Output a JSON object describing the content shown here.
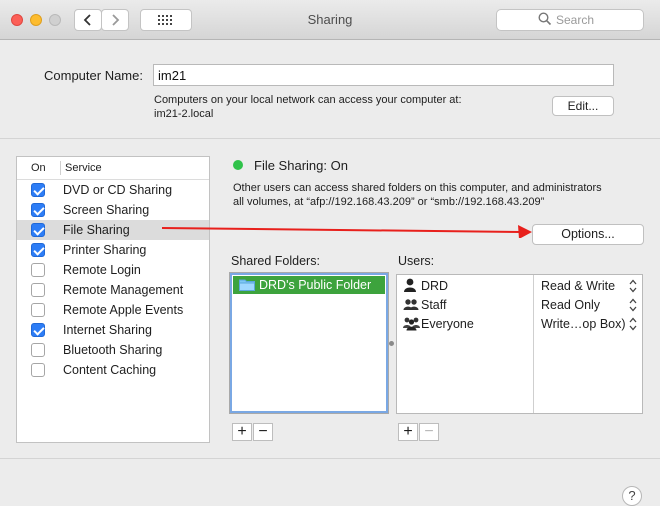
{
  "window": {
    "title": "Sharing"
  },
  "search": {
    "placeholder": "Search"
  },
  "computer_name": {
    "label": "Computer Name:",
    "value": "im21",
    "description_line1": "Computers on your local network can access your computer at:",
    "description_line2": "im21-2.local",
    "edit_label": "Edit..."
  },
  "services": {
    "header_on": "On",
    "header_service": "Service",
    "items": [
      {
        "label": "DVD or CD Sharing",
        "checked": true,
        "selected": false
      },
      {
        "label": "Screen Sharing",
        "checked": true,
        "selected": false
      },
      {
        "label": "File Sharing",
        "checked": true,
        "selected": true
      },
      {
        "label": "Printer Sharing",
        "checked": true,
        "selected": false
      },
      {
        "label": "Remote Login",
        "checked": false,
        "selected": false
      },
      {
        "label": "Remote Management",
        "checked": false,
        "selected": false
      },
      {
        "label": "Remote Apple Events",
        "checked": false,
        "selected": false
      },
      {
        "label": "Internet Sharing",
        "checked": true,
        "selected": false
      },
      {
        "label": "Bluetooth Sharing",
        "checked": false,
        "selected": false
      },
      {
        "label": "Content Caching",
        "checked": false,
        "selected": false
      }
    ]
  },
  "status": {
    "title": "File Sharing: On",
    "color": "#30c24a",
    "description_line1": "Other users can access shared folders on this computer, and administrators",
    "description_line2": "all volumes, at “afp://192.168.43.209” or “smb://192.168.43.209”"
  },
  "options_label": "Options...",
  "shared_folders": {
    "label": "Shared Folders:",
    "items": [
      {
        "label": "DRD's Public Folder"
      }
    ]
  },
  "users": {
    "label": "Users:",
    "items": [
      {
        "name": "DRD",
        "permission": "Read & Write",
        "icon": "single-user-icon"
      },
      {
        "name": "Staff",
        "permission": "Read Only",
        "icon": "group-icon"
      },
      {
        "name": "Everyone",
        "permission": "Write…op Box)",
        "icon": "everyone-icon"
      }
    ]
  },
  "buttons": {
    "add": "+",
    "remove": "−"
  },
  "help": "?",
  "annotation": {
    "arrow_color": "#e8201c"
  }
}
